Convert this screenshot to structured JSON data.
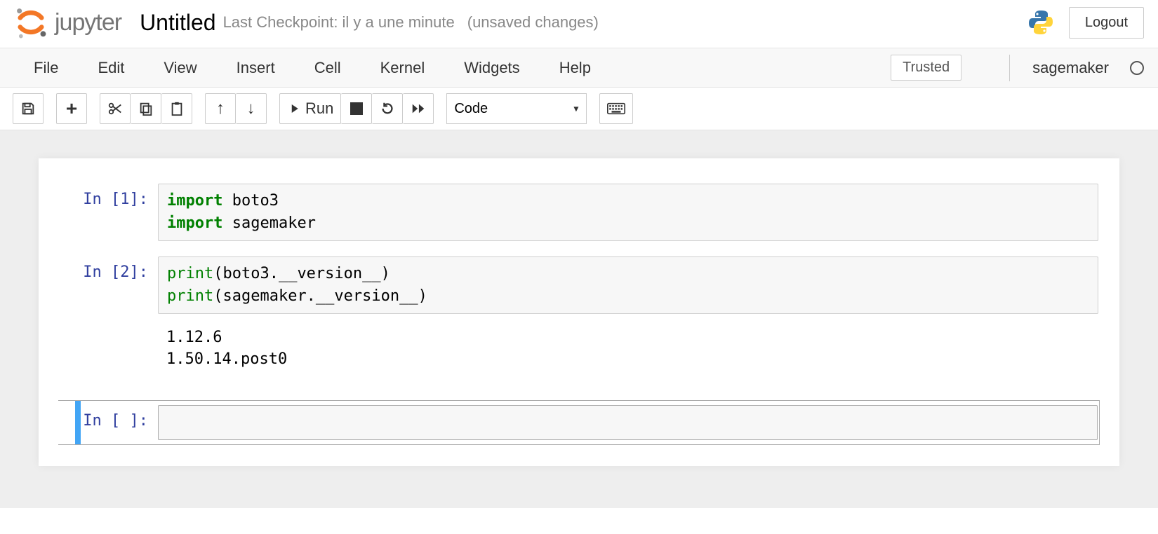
{
  "header": {
    "logo_text": "jupyter",
    "notebook_name": "Untitled",
    "checkpoint": "Last Checkpoint: il y a une minute",
    "unsaved": "(unsaved changes)",
    "logout_label": "Logout"
  },
  "menubar": {
    "items": [
      "File",
      "Edit",
      "View",
      "Insert",
      "Cell",
      "Kernel",
      "Widgets",
      "Help"
    ],
    "trusted_label": "Trusted",
    "kernel_name": "sagemaker"
  },
  "toolbar": {
    "run_label": "Run",
    "cell_type": "Code"
  },
  "cells": [
    {
      "prompt": "In [1]:",
      "code_tokens": [
        {
          "t": "import",
          "c": "keyword"
        },
        {
          "t": " boto3\n",
          "c": "plain"
        },
        {
          "t": "import",
          "c": "keyword"
        },
        {
          "t": " sagemaker",
          "c": "plain"
        }
      ]
    },
    {
      "prompt": "In [2]:",
      "code_tokens": [
        {
          "t": "print",
          "c": "builtin"
        },
        {
          "t": "(boto3.__version__)\n",
          "c": "plain"
        },
        {
          "t": "print",
          "c": "builtin"
        },
        {
          "t": "(sagemaker.__version__)",
          "c": "plain"
        }
      ],
      "output": "1.12.6\n1.50.14.post0"
    },
    {
      "prompt": "In [ ]:",
      "code_tokens": [],
      "selected": true
    }
  ]
}
